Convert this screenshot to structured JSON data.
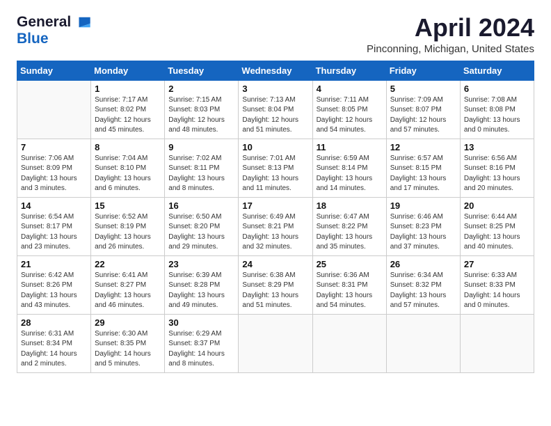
{
  "logo": {
    "general": "General",
    "blue": "Blue"
  },
  "title": "April 2024",
  "location": "Pinconning, Michigan, United States",
  "days_of_week": [
    "Sunday",
    "Monday",
    "Tuesday",
    "Wednesday",
    "Thursday",
    "Friday",
    "Saturday"
  ],
  "weeks": [
    [
      {
        "day": "",
        "info": ""
      },
      {
        "day": "1",
        "info": "Sunrise: 7:17 AM\nSunset: 8:02 PM\nDaylight: 12 hours\nand 45 minutes."
      },
      {
        "day": "2",
        "info": "Sunrise: 7:15 AM\nSunset: 8:03 PM\nDaylight: 12 hours\nand 48 minutes."
      },
      {
        "day": "3",
        "info": "Sunrise: 7:13 AM\nSunset: 8:04 PM\nDaylight: 12 hours\nand 51 minutes."
      },
      {
        "day": "4",
        "info": "Sunrise: 7:11 AM\nSunset: 8:05 PM\nDaylight: 12 hours\nand 54 minutes."
      },
      {
        "day": "5",
        "info": "Sunrise: 7:09 AM\nSunset: 8:07 PM\nDaylight: 12 hours\nand 57 minutes."
      },
      {
        "day": "6",
        "info": "Sunrise: 7:08 AM\nSunset: 8:08 PM\nDaylight: 13 hours\nand 0 minutes."
      }
    ],
    [
      {
        "day": "7",
        "info": "Sunrise: 7:06 AM\nSunset: 8:09 PM\nDaylight: 13 hours\nand 3 minutes."
      },
      {
        "day": "8",
        "info": "Sunrise: 7:04 AM\nSunset: 8:10 PM\nDaylight: 13 hours\nand 6 minutes."
      },
      {
        "day": "9",
        "info": "Sunrise: 7:02 AM\nSunset: 8:11 PM\nDaylight: 13 hours\nand 8 minutes."
      },
      {
        "day": "10",
        "info": "Sunrise: 7:01 AM\nSunset: 8:13 PM\nDaylight: 13 hours\nand 11 minutes."
      },
      {
        "day": "11",
        "info": "Sunrise: 6:59 AM\nSunset: 8:14 PM\nDaylight: 13 hours\nand 14 minutes."
      },
      {
        "day": "12",
        "info": "Sunrise: 6:57 AM\nSunset: 8:15 PM\nDaylight: 13 hours\nand 17 minutes."
      },
      {
        "day": "13",
        "info": "Sunrise: 6:56 AM\nSunset: 8:16 PM\nDaylight: 13 hours\nand 20 minutes."
      }
    ],
    [
      {
        "day": "14",
        "info": "Sunrise: 6:54 AM\nSunset: 8:17 PM\nDaylight: 13 hours\nand 23 minutes."
      },
      {
        "day": "15",
        "info": "Sunrise: 6:52 AM\nSunset: 8:19 PM\nDaylight: 13 hours\nand 26 minutes."
      },
      {
        "day": "16",
        "info": "Sunrise: 6:50 AM\nSunset: 8:20 PM\nDaylight: 13 hours\nand 29 minutes."
      },
      {
        "day": "17",
        "info": "Sunrise: 6:49 AM\nSunset: 8:21 PM\nDaylight: 13 hours\nand 32 minutes."
      },
      {
        "day": "18",
        "info": "Sunrise: 6:47 AM\nSunset: 8:22 PM\nDaylight: 13 hours\nand 35 minutes."
      },
      {
        "day": "19",
        "info": "Sunrise: 6:46 AM\nSunset: 8:23 PM\nDaylight: 13 hours\nand 37 minutes."
      },
      {
        "day": "20",
        "info": "Sunrise: 6:44 AM\nSunset: 8:25 PM\nDaylight: 13 hours\nand 40 minutes."
      }
    ],
    [
      {
        "day": "21",
        "info": "Sunrise: 6:42 AM\nSunset: 8:26 PM\nDaylight: 13 hours\nand 43 minutes."
      },
      {
        "day": "22",
        "info": "Sunrise: 6:41 AM\nSunset: 8:27 PM\nDaylight: 13 hours\nand 46 minutes."
      },
      {
        "day": "23",
        "info": "Sunrise: 6:39 AM\nSunset: 8:28 PM\nDaylight: 13 hours\nand 49 minutes."
      },
      {
        "day": "24",
        "info": "Sunrise: 6:38 AM\nSunset: 8:29 PM\nDaylight: 13 hours\nand 51 minutes."
      },
      {
        "day": "25",
        "info": "Sunrise: 6:36 AM\nSunset: 8:31 PM\nDaylight: 13 hours\nand 54 minutes."
      },
      {
        "day": "26",
        "info": "Sunrise: 6:34 AM\nSunset: 8:32 PM\nDaylight: 13 hours\nand 57 minutes."
      },
      {
        "day": "27",
        "info": "Sunrise: 6:33 AM\nSunset: 8:33 PM\nDaylight: 14 hours\nand 0 minutes."
      }
    ],
    [
      {
        "day": "28",
        "info": "Sunrise: 6:31 AM\nSunset: 8:34 PM\nDaylight: 14 hours\nand 2 minutes."
      },
      {
        "day": "29",
        "info": "Sunrise: 6:30 AM\nSunset: 8:35 PM\nDaylight: 14 hours\nand 5 minutes."
      },
      {
        "day": "30",
        "info": "Sunrise: 6:29 AM\nSunset: 8:37 PM\nDaylight: 14 hours\nand 8 minutes."
      },
      {
        "day": "",
        "info": ""
      },
      {
        "day": "",
        "info": ""
      },
      {
        "day": "",
        "info": ""
      },
      {
        "day": "",
        "info": ""
      }
    ]
  ]
}
